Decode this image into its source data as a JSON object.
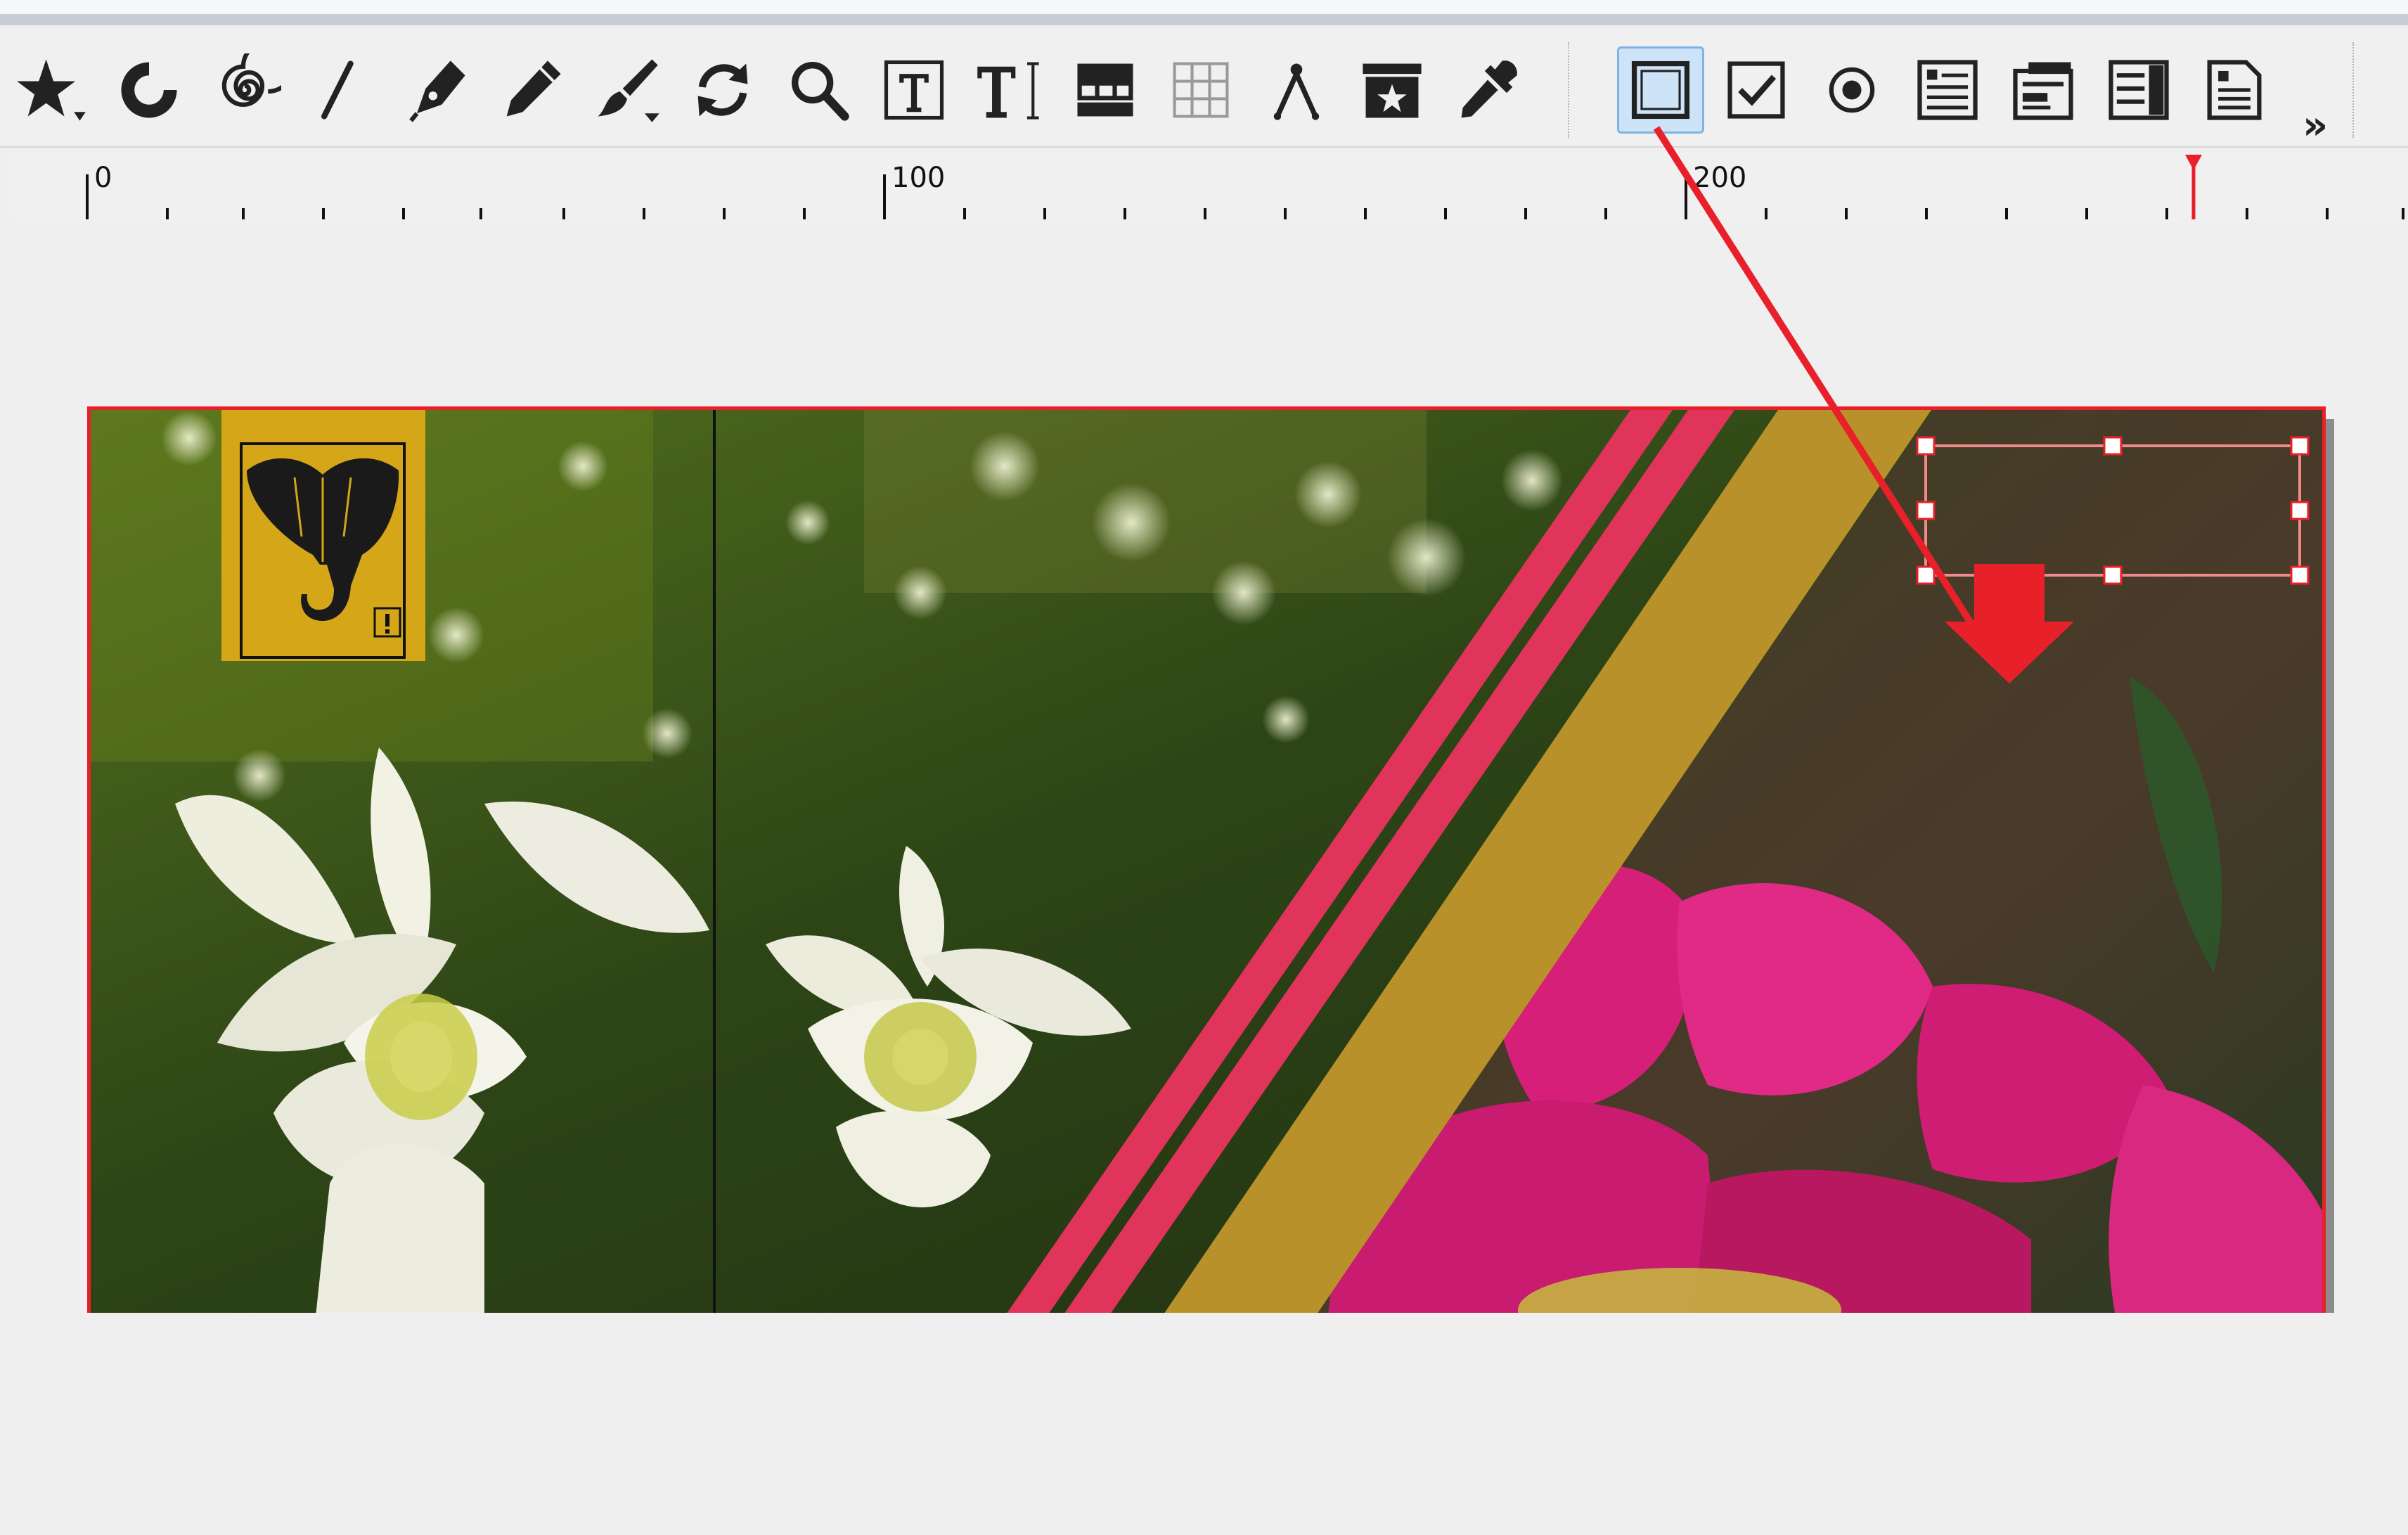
{
  "toolbar": {
    "tools": [
      {
        "icon": "star-icon"
      },
      {
        "icon": "spiral-partial-icon"
      },
      {
        "icon": "spiral-icon"
      },
      {
        "icon": "line-icon"
      },
      {
        "icon": "pen-icon"
      },
      {
        "icon": "pencil-icon"
      },
      {
        "icon": "brush-icon"
      },
      {
        "icon": "rotate-icon"
      },
      {
        "icon": "zoom-icon"
      },
      {
        "icon": "text-frame-icon"
      },
      {
        "icon": "text-cursor-icon"
      },
      {
        "icon": "table-icon"
      },
      {
        "icon": "table-grid-icon"
      },
      {
        "icon": "compass-icon"
      },
      {
        "icon": "symbol-frame-icon"
      },
      {
        "icon": "eyedropper-icon"
      }
    ],
    "form_tools": [
      {
        "icon": "pdf-button-icon",
        "active": true
      },
      {
        "icon": "pdf-checkbox-icon"
      },
      {
        "icon": "pdf-radio-icon"
      },
      {
        "icon": "pdf-text-field-icon"
      },
      {
        "icon": "pdf-combobox-icon"
      },
      {
        "icon": "pdf-listbox-icon"
      },
      {
        "icon": "pdf-text-annotation-icon"
      }
    ],
    "overflow_label": "»"
  },
  "ruler": {
    "labels": [
      "0",
      "100",
      "200"
    ]
  },
  "annotation": {
    "color": "#e8202a"
  },
  "document": {
    "stripes": {
      "red": "#e0345a",
      "gold": "#b8912a"
    },
    "logo_badge": {
      "color": "#d4a618",
      "icon": "elephant-icon",
      "warning_icon": "warning-icon"
    }
  }
}
